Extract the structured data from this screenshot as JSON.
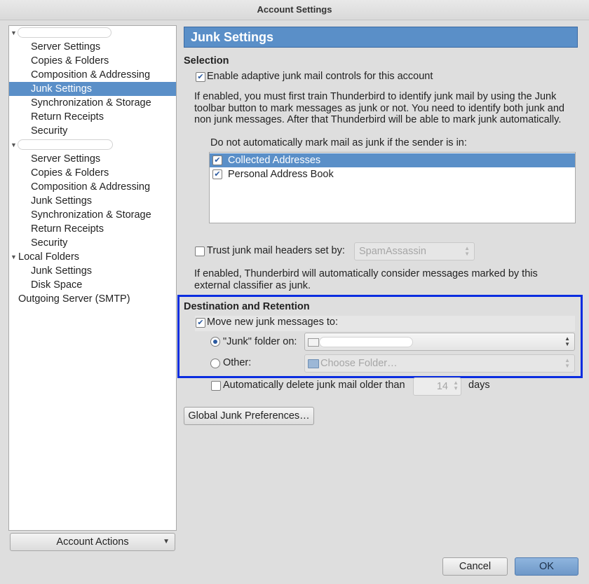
{
  "window": {
    "title": "Account Settings"
  },
  "tree": {
    "accounts": [
      {
        "label": "",
        "items": [
          "Server Settings",
          "Copies & Folders",
          "Composition & Addressing",
          "Junk Settings",
          "Synchronization & Storage",
          "Return Receipts",
          "Security"
        ],
        "selected_index": 3
      },
      {
        "label": "",
        "items": [
          "Server Settings",
          "Copies & Folders",
          "Composition & Addressing",
          "Junk Settings",
          "Synchronization & Storage",
          "Return Receipts",
          "Security"
        ]
      },
      {
        "label": "Local Folders",
        "items": [
          "Junk Settings",
          "Disk Space"
        ]
      }
    ],
    "outgoing": "Outgoing Server (SMTP)",
    "account_actions": "Account Actions"
  },
  "pane": {
    "header": "Junk Settings",
    "selection": {
      "heading": "Selection",
      "enable_label": "Enable adaptive junk mail controls for this account",
      "enable_checked": true,
      "description_lines": [
        "If enabled, you must first train Thunderbird to identify junk mail by using the Junk",
        "toolbar button to mark messages as junk or not. You need to identify both junk and",
        "non junk messages. After that Thunderbird will be able to mark junk automatically."
      ],
      "whitelist_label": "Do not automatically mark mail as junk if the sender is in:",
      "address_books": [
        {
          "label": "Collected Addresses",
          "checked": true,
          "selected": true
        },
        {
          "label": "Personal Address Book",
          "checked": true,
          "selected": false
        }
      ],
      "trust_label": "Trust junk mail headers set by:",
      "trust_checked": false,
      "trust_value": "SpamAssassin",
      "trust_description_lines": [
        "If enabled, Thunderbird will automatically consider messages marked by this",
        "external classifier as junk."
      ]
    },
    "destination": {
      "heading": "Destination and Retention",
      "move_label": "Move new junk messages to:",
      "move_checked": true,
      "junk_folder_label": "\"Junk\" folder on:",
      "junk_folder_selected": true,
      "junk_folder_value": "",
      "other_label": "Other:",
      "other_placeholder": "Choose Folder…",
      "auto_delete_label": "Automatically delete junk mail older than",
      "auto_delete_checked": false,
      "auto_delete_days": "14",
      "days_label": "days"
    },
    "global_prefs_button": "Global Junk Preferences…"
  },
  "footer": {
    "cancel": "Cancel",
    "ok": "OK"
  },
  "colors": {
    "selection": "#5a8fc8",
    "highlight_box": "#0a2de0"
  },
  "icons": [
    "mail-icon",
    "folder-icon",
    "checkbox-check-icon",
    "dropdown-arrow-icon",
    "spin-arrows-icon"
  ]
}
